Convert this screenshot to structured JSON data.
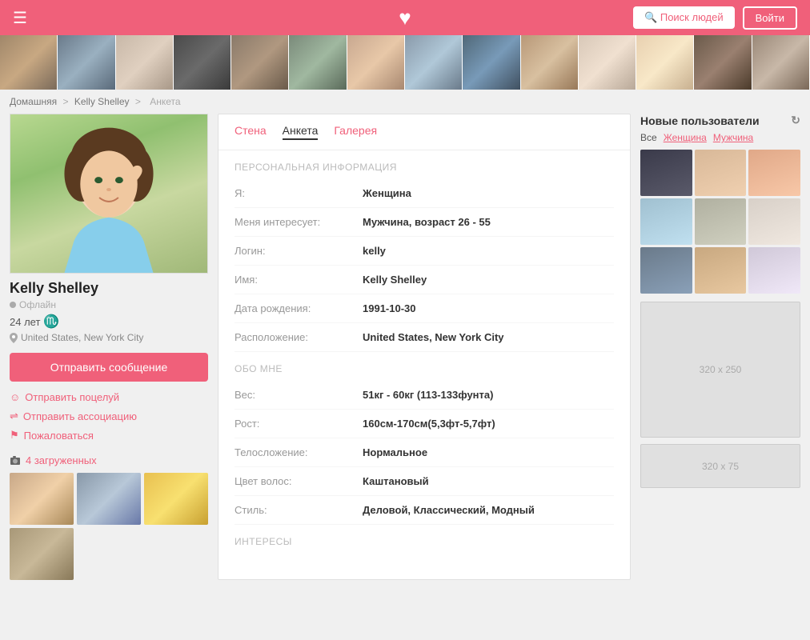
{
  "header": {
    "menu_icon": "☰",
    "logo": "♥",
    "search_button": "🔍 Поиск людей",
    "login_button": "Войти"
  },
  "breadcrumb": {
    "home": "Домашняя",
    "sep1": ">",
    "user": "Kelly Shelley",
    "sep2": ">",
    "current": "Анкета"
  },
  "profile": {
    "name": "Kelly Shelley",
    "status": "Офлайн",
    "age": "24 лет",
    "zodiac": "♏",
    "location": "United States, New York City",
    "message_button": "Отправить сообщение",
    "actions": {
      "kiss": "Отправить поцелуй",
      "association": "Отправить ассоциацию",
      "report": "Пожаловаться"
    },
    "photos_label": "4 загруженных"
  },
  "tabs": {
    "wall": "Стена",
    "profile": "Анкета",
    "gallery": "Галерея"
  },
  "personal_info": {
    "section_label": "ПЕРСОНАЛЬНАЯ ИНФОРМАЦИЯ",
    "gender_label": "Я:",
    "gender_value": "Женщина",
    "interest_label": "Меня интересует:",
    "interest_value": "Мужчина, возраст 26 - 55",
    "login_label": "Логин:",
    "login_value": "kelly",
    "name_label": "Имя:",
    "name_value": "Kelly Shelley",
    "dob_label": "Дата рождения:",
    "dob_value": "1991-10-30",
    "location_label": "Расположение:",
    "location_value": "United States, New York City"
  },
  "about_me": {
    "section_label": "ОБО МНЕ",
    "weight_label": "Вес:",
    "weight_value": "51кг - 60кг (113-133фунта)",
    "height_label": "Рост:",
    "height_value": "160см-170см(5,3фт-5,7фт)",
    "build_label": "Телосложение:",
    "build_value": "Нормальное",
    "hair_label": "Цвет волос:",
    "hair_value": "Каштановый",
    "style_label": "Стиль:",
    "style_value": "Деловой, Классический, Модный"
  },
  "interests": {
    "section_label": "ИНТЕРЕСЫ"
  },
  "new_users": {
    "title": "Новые пользователи",
    "refresh_icon": "↻",
    "filter_all": "Все",
    "filter_female": "Женщина",
    "filter_male": "Мужчина"
  },
  "ads": {
    "ad1_size": "320 x 250",
    "ad2_size": "320 x 75"
  },
  "colors": {
    "primary": "#f0607a",
    "bg": "#f0f0f0",
    "white": "#ffffff"
  }
}
